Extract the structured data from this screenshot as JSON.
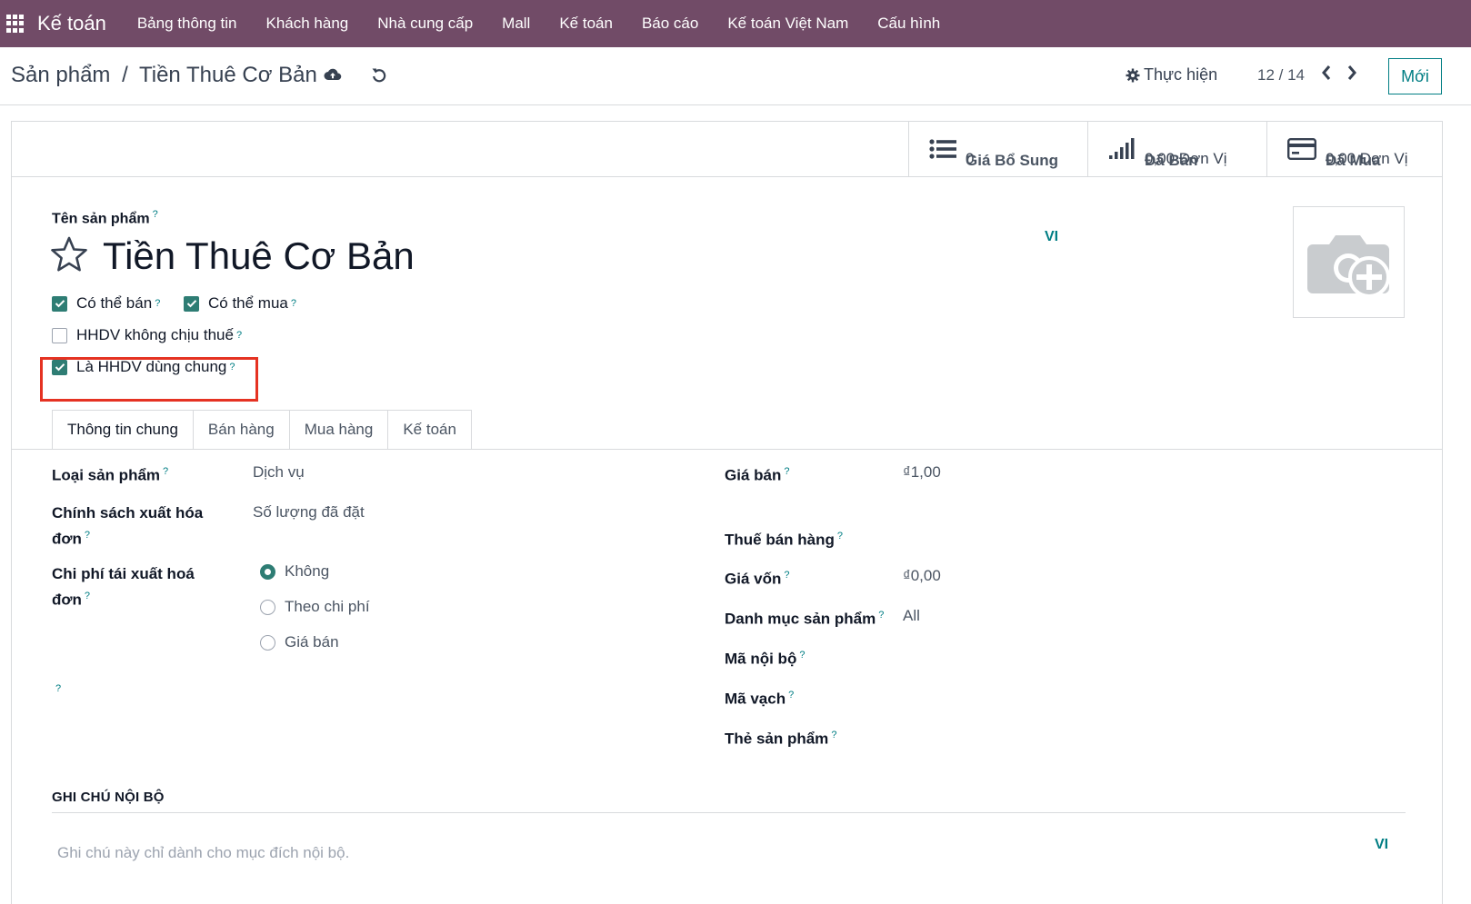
{
  "topbar": {
    "app_name": "Kế toán",
    "menu": [
      "Bảng thông tin",
      "Khách hàng",
      "Nhà cung cấp",
      "Mall",
      "Kế toán",
      "Báo cáo",
      "Kế toán Việt Nam",
      "Cấu hình"
    ]
  },
  "control": {
    "breadcrumb_parent": "Sản phẩm",
    "breadcrumb_sep": "/",
    "breadcrumb_current": "Tiền Thuê Cơ Bản",
    "action_label": "Thực hiện",
    "pager": "12 / 14",
    "new_label": "Mới"
  },
  "stat_buttons": [
    {
      "value": "0",
      "label": "Giá Bổ Sung",
      "icon": "list-icon"
    },
    {
      "value": "0,00 Đơn Vị",
      "label": "Đã Bán",
      "icon": "signal-bars-icon"
    },
    {
      "value": "0,00 Đơn Vị",
      "label": "Đã Mua",
      "icon": "credit-card-icon"
    }
  ],
  "product": {
    "name_label": "Tên sản phẩm",
    "name": "Tiền Thuê Cơ Bản",
    "lang": "VI",
    "help_mark": "?"
  },
  "checkboxes": {
    "can_sell": {
      "label": "Có thể bán",
      "checked": true
    },
    "can_buy": {
      "label": "Có thể mua",
      "checked": true
    },
    "no_tax": {
      "label": "HHDV không chịu thuế",
      "checked": false
    },
    "shared": {
      "label": "Là HHDV dùng chung",
      "checked": true
    }
  },
  "tabs": [
    "Thông tin chung",
    "Bán hàng",
    "Mua hàng",
    "Kế toán"
  ],
  "general": {
    "product_type_label": "Loại sản phẩm",
    "product_type": "Dịch vụ",
    "invoice_policy_label_1": "Chính sách xuất hóa",
    "invoice_policy_label_2": "đơn",
    "invoice_policy": "Số lượng đã đặt",
    "reinvoice_label_1": "Chi phí tái xuất hoá",
    "reinvoice_label_2": "đơn",
    "reinvoice_options": [
      {
        "label": "Không",
        "selected": true
      },
      {
        "label": "Theo chi phí",
        "selected": false
      },
      {
        "label": "Giá bán",
        "selected": false
      }
    ],
    "sale_price_label": "Giá bán",
    "sale_price": "₫1,00",
    "sale_tax_label": "Thuế bán hàng",
    "cost_label": "Giá vốn",
    "cost": "₫0,00",
    "category_label": "Danh mục sản phẩm",
    "category": "All",
    "internal_ref_label": "Mã nội bộ",
    "barcode_label": "Mã vạch",
    "tags_label": "Thẻ sản phẩm"
  },
  "notes": {
    "title": "GHI CHÚ NỘI BỘ",
    "placeholder": "Ghi chú này chỉ dành cho mục đích nội bộ.",
    "lang": "VI"
  },
  "colors": {
    "brand": "#714b67",
    "accent": "#017e84",
    "check": "#2e7d74",
    "highlight": "#e53222"
  }
}
